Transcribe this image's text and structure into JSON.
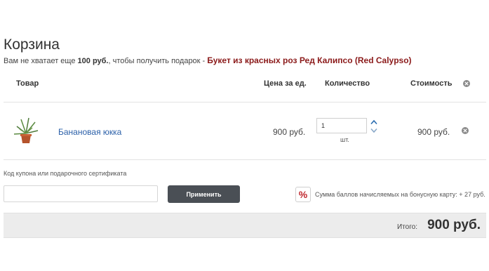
{
  "page": {
    "title": "Корзина"
  },
  "promo": {
    "prefix": "Вам не хватает еще",
    "amount": "100 руб.",
    "middle": ", чтобы получить подарок -",
    "gift_name": "Букет из красных роз Ред Калипсо (Red Calypso)"
  },
  "table": {
    "headers": {
      "product": "Товар",
      "unit_price": "Цена за ед.",
      "quantity": "Количество",
      "cost": "Стоимость"
    },
    "items": [
      {
        "name": "Банановая юкка",
        "unit_price": "900 руб.",
        "quantity": "1",
        "unit": "шт.",
        "cost": "900 руб."
      }
    ]
  },
  "coupon": {
    "label": "Код купона или подарочного сертификата",
    "value": "",
    "apply_label": "Применить"
  },
  "bonus": {
    "badge": "%",
    "text": "Сумма баллов начисляемых на бонусную карту: + 27 руб."
  },
  "total": {
    "label": "Итого:",
    "value": "900 руб."
  },
  "colors": {
    "gift": "#8b1a1a",
    "link": "#2a5fa8",
    "button": "#4a4f55",
    "accent_arrows": "#2a6db0",
    "bonus_badge": "#c0282e"
  },
  "icons": {
    "remove": "close-circle-icon",
    "qty_up": "chevron-up-icon",
    "qty_down": "chevron-down-icon"
  }
}
